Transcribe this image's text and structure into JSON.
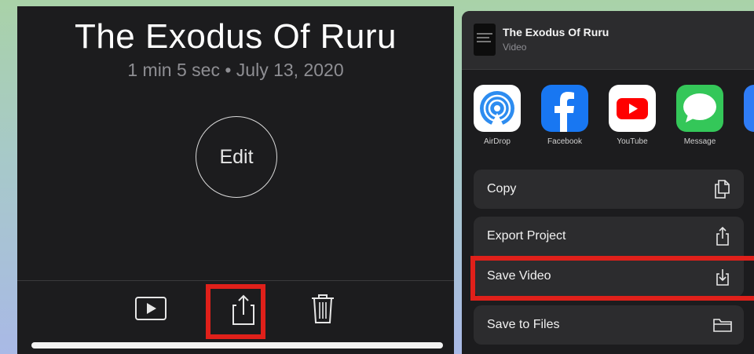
{
  "left": {
    "title": "The Exodus Of Ruru",
    "subtitle": "1 min 5 sec • July 13, 2020",
    "edit_label": "Edit",
    "toolbar": {
      "play_icon": "play-icon",
      "share_icon": "share-icon",
      "trash_icon": "trash-icon"
    }
  },
  "right": {
    "header": {
      "title": "The Exodus Of Ruru",
      "subtitle": "Video"
    },
    "apps": [
      {
        "label": "AirDrop",
        "icon": "airdrop-icon"
      },
      {
        "label": "Facebook",
        "icon": "facebook-icon"
      },
      {
        "label": "YouTube",
        "icon": "youtube-icon"
      },
      {
        "label": "Message",
        "icon": "message-icon"
      }
    ],
    "actions": [
      {
        "label": "Copy",
        "icon": "copy-icon"
      },
      {
        "label": "Export Project",
        "icon": "share-icon"
      },
      {
        "label": "Save Video",
        "icon": "save-icon"
      },
      {
        "label": "Save to Files",
        "icon": "folder-icon"
      }
    ]
  },
  "colors": {
    "highlight": "#e0201a",
    "panel_bg": "#1c1c1e",
    "row_bg": "#2c2c2e"
  }
}
